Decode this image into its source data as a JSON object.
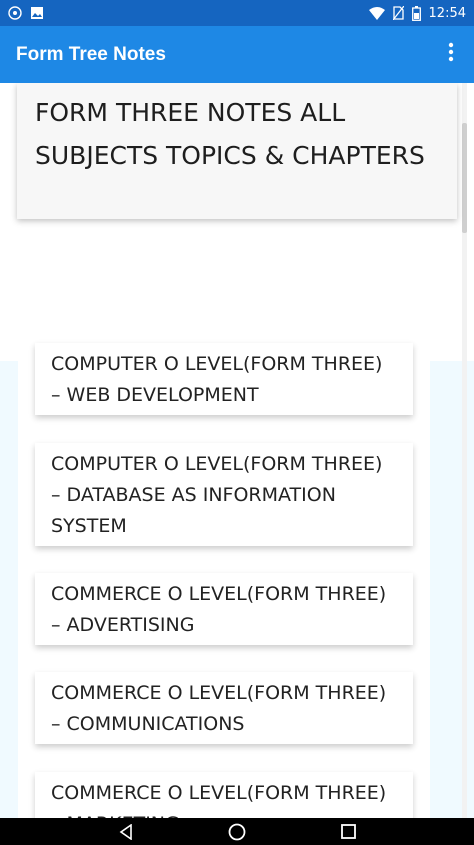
{
  "status_bar": {
    "time": "12:54",
    "left_icons": [
      "hotspot-icon",
      "image-icon"
    ],
    "right_icons": [
      "wifi-icon",
      "no-sim-icon",
      "battery-icon"
    ]
  },
  "app_bar": {
    "title": "Form Tree Notes",
    "menu_icon": "more-vert-icon"
  },
  "header": {
    "title": "FORM THREE NOTES ALL SUBJECTS TOPICS & CHAPTERS"
  },
  "list": {
    "items": [
      {
        "label": "COMPUTER O LEVEL(FORM THREE) – WEB DEVELOPMENT"
      },
      {
        "label": "COMPUTER O LEVEL(FORM THREE) – DATABASE AS INFORMATION SYSTEM"
      },
      {
        "label": "COMMERCE O LEVEL(FORM THREE) – ADVERTISING"
      },
      {
        "label": "COMMERCE O LEVEL(FORM THREE) – COMMUNICATIONS"
      },
      {
        "label": "COMMERCE O LEVEL(FORM THREE) – MARKETING"
      }
    ]
  },
  "nav_bar": {
    "icons": [
      "back-icon",
      "home-icon",
      "recents-icon"
    ]
  },
  "colors": {
    "status_bar": "#1565c0",
    "app_bar": "#1e88e5",
    "background": "#f0faff"
  }
}
